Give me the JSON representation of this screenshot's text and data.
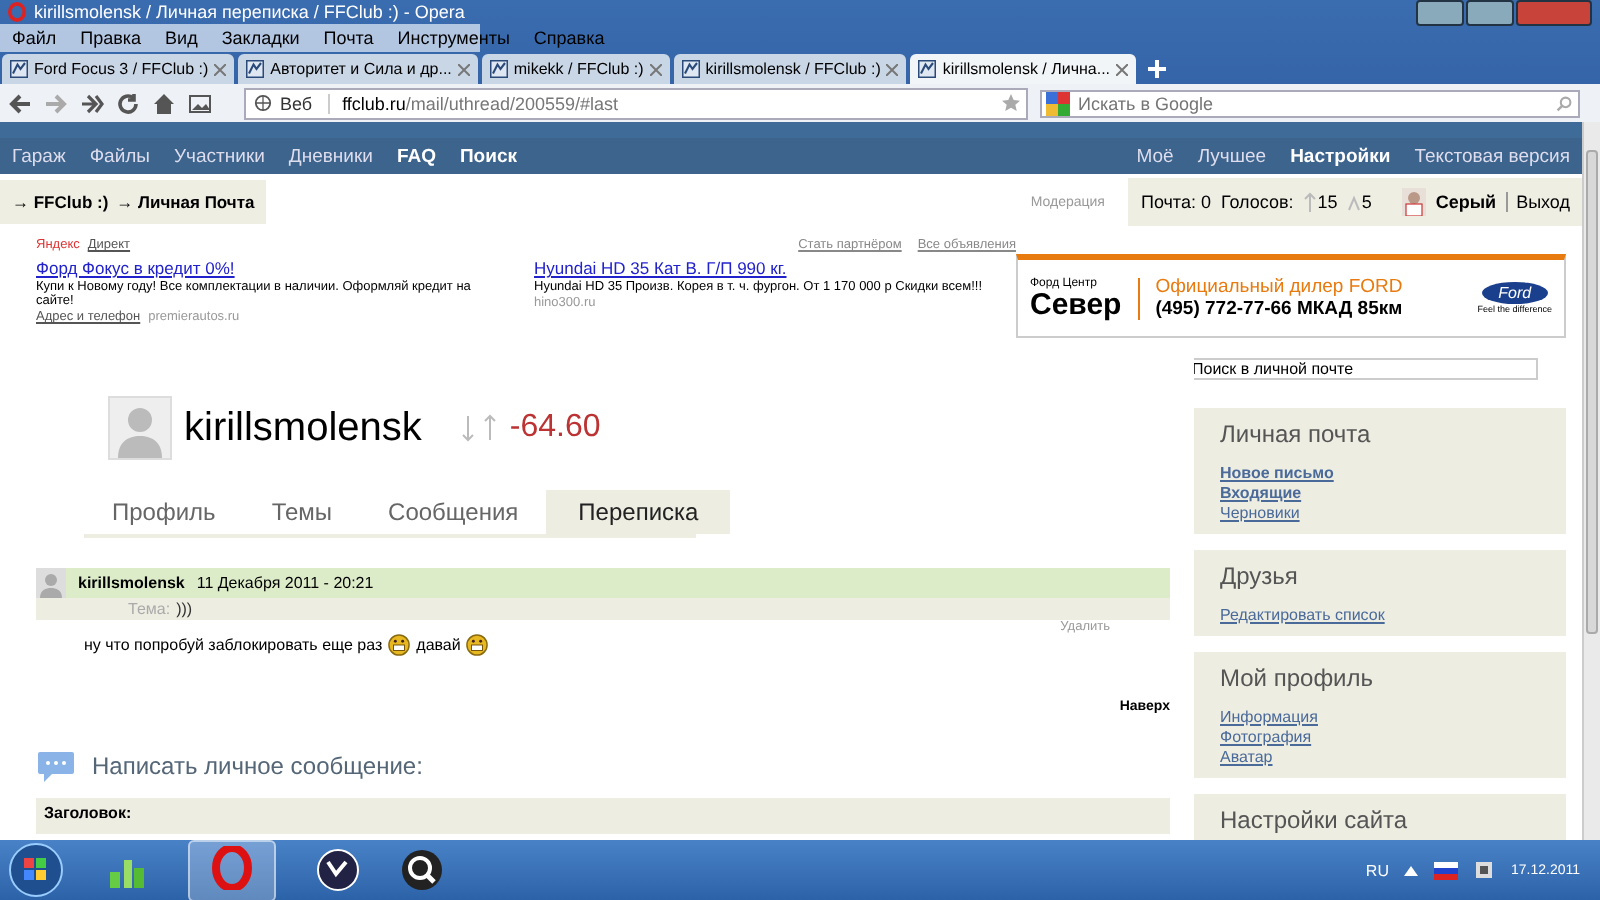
{
  "window": {
    "title": "kirillsmolensk / Личная переписка / FFClub :) - Opera"
  },
  "menu": [
    "Файл",
    "Правка",
    "Вид",
    "Закладки",
    "Почта",
    "Инструменты",
    "Справка"
  ],
  "tabs": [
    {
      "label": "Ford Focus 3 / FFClub :)",
      "selected": false
    },
    {
      "label": "Авторитет и Сила и др...",
      "selected": false
    },
    {
      "label": "mikekk / FFClub :)",
      "selected": false
    },
    {
      "label": "kirillsmolensk / FFClub :)",
      "selected": false
    },
    {
      "label": "kirillsmolensk / Лична...",
      "selected": true
    }
  ],
  "address_bar": {
    "search_label": "Веб",
    "url_host": "ffclub.ru",
    "url_path": "/mail/uthread/200559/#last"
  },
  "search": {
    "placeholder": "Искать в Google"
  },
  "site_nav": {
    "left": [
      {
        "label": "Гараж",
        "bold": false
      },
      {
        "label": "Файлы",
        "bold": false
      },
      {
        "label": "Участники",
        "bold": false
      },
      {
        "label": "Дневники",
        "bold": false
      },
      {
        "label": "FAQ",
        "bold": true
      },
      {
        "label": "Поиск",
        "bold": true
      }
    ],
    "right": [
      {
        "label": "Моё",
        "bold": false
      },
      {
        "label": "Лучшее",
        "bold": false
      },
      {
        "label": "Настройки",
        "bold": true
      },
      {
        "label": "Текстовая версия",
        "bold": false
      }
    ]
  },
  "breadcrumb": [
    "→ FFClub :)",
    "→ Личная Почта"
  ],
  "user_bar": {
    "moderation": "Модерация",
    "mail": "Почта: 0",
    "votes_label": "Голосов:",
    "votes_up": "15",
    "votes_power": "5",
    "username": "Серый",
    "logout": "Выход"
  },
  "ads": {
    "provider": "Яндекс",
    "direct": "Директ",
    "partner_link": "Стать партнёром",
    "all_ads": "Все объявления",
    "items": [
      {
        "title": "Форд Фокус в кредит 0%!",
        "text": "Купи к Новому году! Все комплектации в наличии. Оформляй кредит на сайте!",
        "address": "Адрес и телефон",
        "domain": "premierautos.ru"
      },
      {
        "title": "Hyundai HD 35 Кат В. Г/П 990 кг.",
        "text": "Hyundai HD 35 Произв. Корея в т. ч. фургон. От 1 170 000 р Скидки всем!!!",
        "domain": "hino300.ru"
      }
    ]
  },
  "banner": {
    "brand_small": "Форд Центр",
    "brand": "Север",
    "headline": "Официальный дилер FORD",
    "phone": "(495) 772-77-66 МКАД 85км",
    "logo": "Ford",
    "slogan": "Feel the difference"
  },
  "mail_search": {
    "value": "Поиск в личной почте"
  },
  "profile": {
    "username": "kirillsmolensk",
    "rating": "-64.60"
  },
  "profile_tabs": [
    {
      "label": "Профиль",
      "selected": false
    },
    {
      "label": "Темы",
      "selected": false
    },
    {
      "label": "Сообщения",
      "selected": false
    },
    {
      "label": "Переписка",
      "selected": true
    }
  ],
  "message": {
    "author": "kirillsmolensk",
    "date": "11 Декабря 2011 - 20:21",
    "subject_label": "Тема:",
    "subject": ")))",
    "delete": "Удалить",
    "body": [
      {
        "kind": "text",
        "text": "ну что попробуй заблокировать еще раз"
      },
      {
        "kind": "emoticon"
      },
      {
        "kind": "text",
        "text": "давай"
      },
      {
        "kind": "emoticon"
      }
    ]
  },
  "to_top": "Наверх",
  "compose": {
    "title": "Написать личное сообщение:",
    "field_label": "Заголовок:"
  },
  "sidebar": [
    {
      "title": "Личная почта",
      "links": [
        {
          "label": "Новое письмо",
          "bold": true
        },
        {
          "label": "Входящие",
          "bold": true
        },
        {
          "label": "Черновики",
          "bold": false
        }
      ]
    },
    {
      "title": "Друзья",
      "links": [
        {
          "label": "Редактировать список",
          "bold": false
        }
      ]
    },
    {
      "title": "Мой профиль",
      "links": [
        {
          "label": "Информация",
          "bold": false
        },
        {
          "label": "Фотография",
          "bold": false
        },
        {
          "label": "Аватар",
          "bold": false
        }
      ]
    },
    {
      "title": "Настройки сайта"
    }
  ],
  "taskbar": {
    "language": "RU",
    "clock": "17.12.2011"
  }
}
